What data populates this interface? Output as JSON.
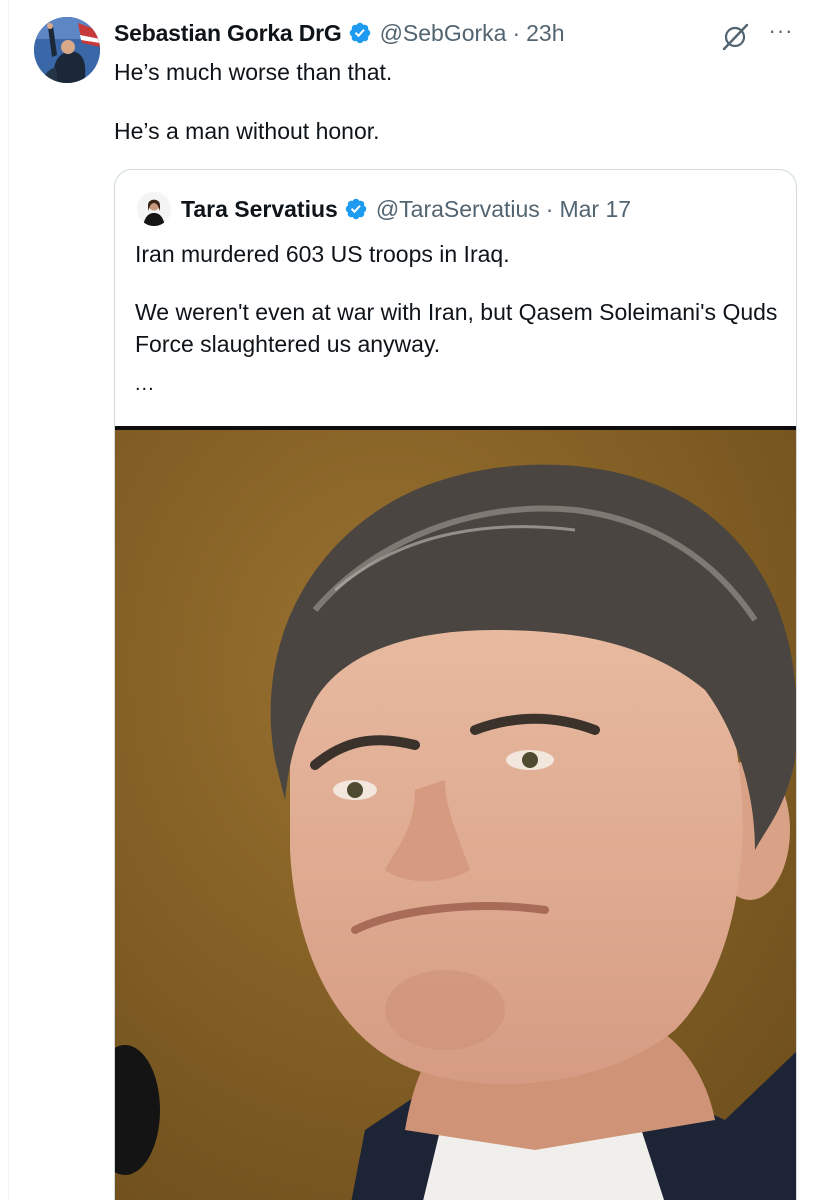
{
  "tweet": {
    "author_name": "Sebastian Gorka DrG",
    "handle": "@SebGorka",
    "separator": "·",
    "time": "23h",
    "text_line1": "He’s much worse than that.",
    "text_line2": "He’s a man without honor.",
    "more_icon": "···"
  },
  "quoted": {
    "author_name": "Tara Servatius",
    "handle": "@TaraServatius",
    "separator": "·",
    "time": "Mar 17",
    "text_line1": "Iran murdered 603 US troops in Iraq.",
    "text_line2": "We weren't even at war with Iran, but Qasem Soleimani's Quds Force slaughtered us anyway.",
    "ellipsis": "..."
  },
  "colors": {
    "verified": "#1d9bf0",
    "secondary_text": "#536471",
    "border": "#cfd9de",
    "media_background": "#8b6524"
  },
  "icons": {
    "verified": "verified-badge-icon",
    "grok": "grok-icon",
    "more": "more-options-icon"
  }
}
